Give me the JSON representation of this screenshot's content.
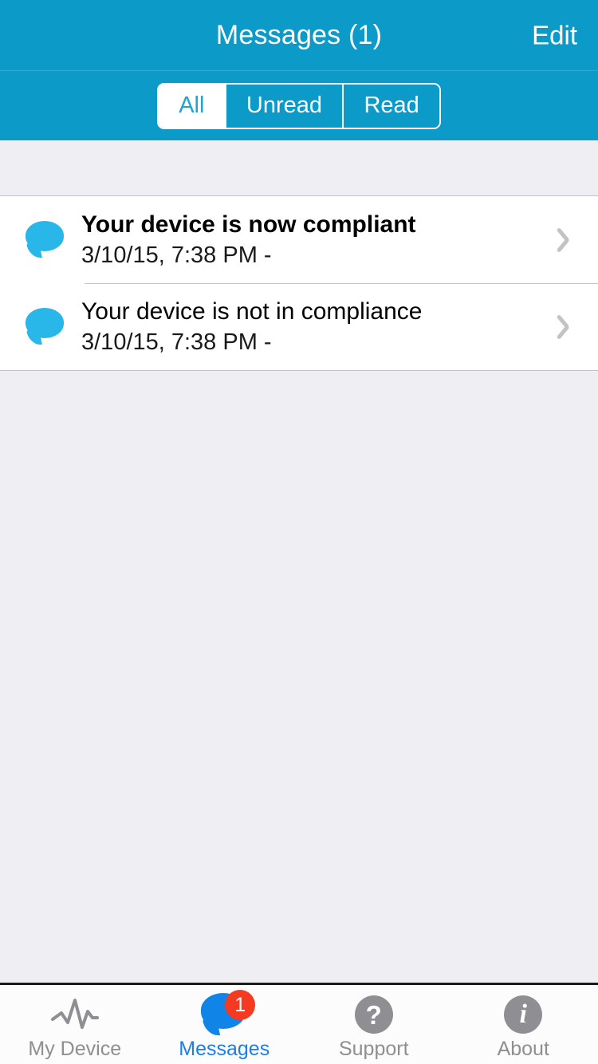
{
  "header": {
    "title": "Messages (1)",
    "edit_label": "Edit",
    "background_color": "#0C9AC9"
  },
  "filter": {
    "segments": [
      {
        "label": "All",
        "selected": true
      },
      {
        "label": "Unread",
        "selected": false
      },
      {
        "label": "Read",
        "selected": false
      }
    ]
  },
  "messages": [
    {
      "title": "Your device is now compliant",
      "subtitle": "3/10/15, 7:38 PM -",
      "unread": true,
      "icon": "speech-bubble-icon",
      "accessory": "chevron-right-icon"
    },
    {
      "title": "Your device is not in compliance",
      "subtitle": "3/10/15, 7:38 PM -",
      "unread": false,
      "icon": "speech-bubble-icon",
      "accessory": "chevron-right-icon"
    }
  ],
  "tabbar": {
    "items": [
      {
        "label": "My Device",
        "icon": "pulse-icon",
        "active": false,
        "badge": null
      },
      {
        "label": "Messages",
        "icon": "speech-bubble-icon",
        "active": true,
        "badge": "1"
      },
      {
        "label": "Support",
        "icon": "question-mark-icon",
        "active": false,
        "badge": null
      },
      {
        "label": "About",
        "icon": "info-icon",
        "active": false,
        "badge": null
      }
    ],
    "active_color": "#1B7FE9",
    "inactive_color": "#8E8E93",
    "badge_color": "#F53A21"
  },
  "glyphs": {
    "question_mark": "?",
    "info": "i"
  }
}
